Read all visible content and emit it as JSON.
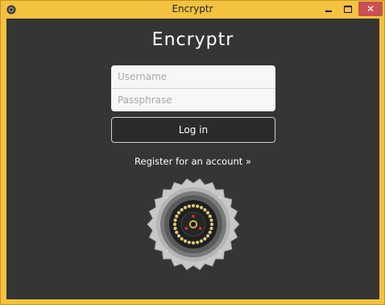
{
  "window": {
    "title": "Encryptr",
    "controls": {
      "minimize": "minimize",
      "maximize": "maximize",
      "close": "✕"
    }
  },
  "app": {
    "logo_text": "Encryptr"
  },
  "login_form": {
    "username_placeholder": "Username",
    "passphrase_placeholder": "Passphrase",
    "username_value": "",
    "passphrase_value": "",
    "login_label": "Log in",
    "register_label": "Register for an account »"
  },
  "icons": {
    "app_icon": "vault-icon",
    "illustration": "vault-dial-icon"
  },
  "colors": {
    "title_bar": "#f3c23f",
    "background": "#353535",
    "close_button": "#c75050",
    "vault_dots": "#d8c87a",
    "vault_center_red": "#d33a3a"
  }
}
